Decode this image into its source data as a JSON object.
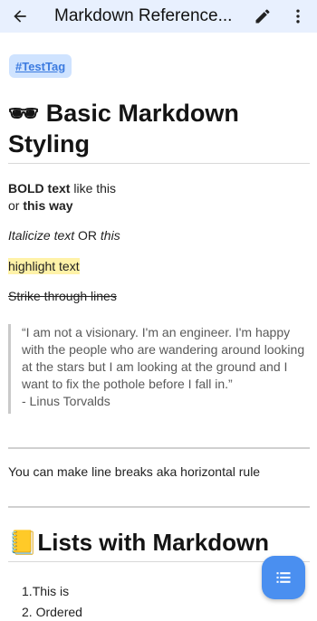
{
  "app_bar": {
    "title": "Markdown Reference...",
    "back_icon": "arrow-left-icon",
    "edit_icon": "pencil-icon",
    "more_icon": "more-vert-icon"
  },
  "tag": "#TestTag",
  "section1": {
    "emoji": "🕶",
    "title": "Basic Markdown Styling"
  },
  "bold_line": {
    "bold1": "BOLD text",
    "plain": " like this",
    "or": "or ",
    "bold2": "this way"
  },
  "italic_line": {
    "italic1": "Italicize text",
    "plain": " OR ",
    "italic2": "this"
  },
  "highlight": "highlight text",
  "strike": "Strike through lines",
  "quote": {
    "text": "“I am not a visionary. I'm an engineer. I'm happy with the people who are wandering around looking at the stars but I am looking at the ground and I want to fix the pothole before I fall in.”",
    "author": "- Linus Torvalds"
  },
  "line_breaks": "You can make line breaks aka horizontal rule",
  "section2": {
    "emoji": "📒",
    "title": "Lists with Markdown"
  },
  "list": [
    {
      "num": "1.",
      "text": "This is"
    },
    {
      "num": "2.",
      "text": "Ordered"
    }
  ],
  "fab_icon": "list-icon",
  "colors": {
    "app_bar_bg": "#e8f0fe",
    "tag_bg": "#cfe3ff",
    "tag_text": "#3c7be0",
    "highlight_bg": "#fff2a8",
    "fab_bg": "#4a8ff0"
  }
}
